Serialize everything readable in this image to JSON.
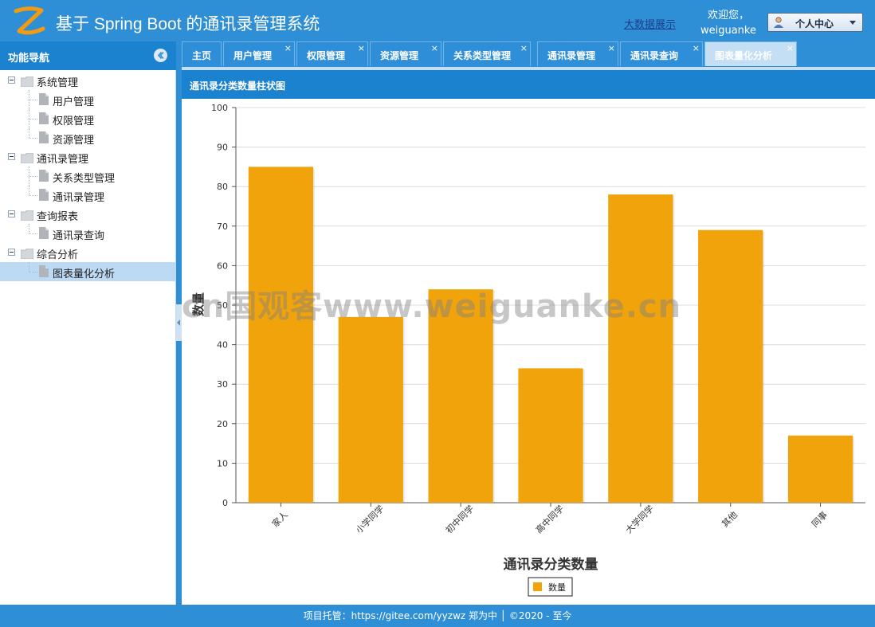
{
  "header": {
    "title": "基于 Spring Boot 的通讯录管理系统",
    "bigdata_link": "大数据展示",
    "welcome_line1": "欢迎您，",
    "welcome_line2": "weiguanke",
    "personal_center": "个人中心"
  },
  "sidebar": {
    "title": "功能导航",
    "groups": [
      {
        "label": "系统管理",
        "items": [
          {
            "label": "用户管理"
          },
          {
            "label": "权限管理"
          },
          {
            "label": "资源管理"
          }
        ]
      },
      {
        "label": "通讯录管理",
        "items": [
          {
            "label": "关系类型管理"
          },
          {
            "label": "通讯录管理"
          }
        ]
      },
      {
        "label": "查询报表",
        "items": [
          {
            "label": "通讯录查询"
          }
        ]
      },
      {
        "label": "综合分析",
        "items": [
          {
            "label": "图表量化分析",
            "selected": true
          }
        ]
      }
    ]
  },
  "tabs": [
    {
      "label": "主页",
      "closable": false
    },
    {
      "label": "用户管理",
      "closable": true
    },
    {
      "label": "权限管理",
      "closable": true
    },
    {
      "label": "资源管理",
      "closable": true
    },
    {
      "label": "关系类型管理",
      "closable": true
    },
    {
      "label": "通讯录管理",
      "closable": true
    },
    {
      "label": "通讯录查询",
      "closable": true
    },
    {
      "label": "图表量化分析",
      "closable": true,
      "active": true
    }
  ],
  "tab_close_glyph": "×",
  "panel": {
    "title": "通讯录分类数量柱状图"
  },
  "chart_data": {
    "type": "bar",
    "categories": [
      "家人",
      "小学同学",
      "初中同学",
      "高中同学",
      "大学同学",
      "其他",
      "同事"
    ],
    "series": [
      {
        "name": "数量",
        "values": [
          85,
          47,
          54,
          34,
          78,
          69,
          17
        ],
        "color": "#f0a30a"
      }
    ],
    "title": "通讯录分类数量",
    "xlabel": "",
    "ylabel": "数量",
    "ylim": [
      0,
      100
    ],
    "yticks": [
      "0",
      "10",
      "20",
      "30",
      "40",
      "50",
      "60",
      "70",
      "80",
      "90",
      "100"
    ],
    "grid": true,
    "legend": "bottom-center"
  },
  "watermark": "cn国观客www.weiguanke.cn",
  "footer": {
    "text": "项目托管：https://gitee.com/yyzwz 郑为中 │  ©2020 - 至今"
  },
  "colors": {
    "header": "#2f8fd6",
    "panel_header": "#1b82d0",
    "bar": "#f0a30a",
    "selected_row": "#bcdaf3"
  }
}
